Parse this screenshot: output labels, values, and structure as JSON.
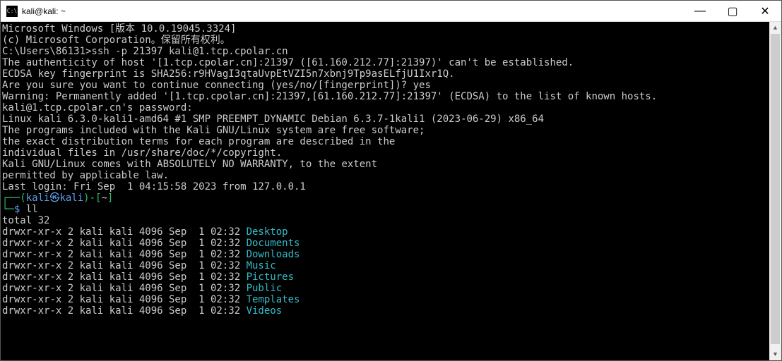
{
  "titlebar": {
    "icon_label": "C:\\",
    "title": "kali@kali: ~"
  },
  "window_controls": {
    "minimize": "—",
    "maximize": "▢",
    "close": "✕"
  },
  "scrollbar": {
    "up": "▲",
    "down": "▼"
  },
  "term": {
    "l1": "Microsoft Windows [版本 10.0.19045.3324]",
    "l2": "(c) Microsoft Corporation。保留所有权利。",
    "blank": "",
    "l3": "C:\\Users\\86131>ssh -p 21397 kali@1.tcp.cpolar.cn",
    "l4": "The authenticity of host '[1.tcp.cpolar.cn]:21397 ([61.160.212.77]:21397)' can't be established.",
    "l5": "ECDSA key fingerprint is SHA256:r9HVagI3qtaUvpEtVZI5n7xbnj9Tp9asELfjU1Ixr1Q.",
    "l6": "Are you sure you want to continue connecting (yes/no/[fingerprint])? yes",
    "l7": "Warning: Permanently added '[1.tcp.cpolar.cn]:21397,[61.160.212.77]:21397' (ECDSA) to the list of known hosts.",
    "l8": "kali@1.tcp.cpolar.cn's password:",
    "l9": "Linux kali 6.3.0-kali1-amd64 #1 SMP PREEMPT_DYNAMIC Debian 6.3.7-1kali1 (2023-06-29) x86_64",
    "l10": "The programs included with the Kali GNU/Linux system are free software;",
    "l11": "the exact distribution terms for each program are described in the",
    "l12": "individual files in /usr/share/doc/*/copyright.",
    "l13": "Kali GNU/Linux comes with ABSOLUTELY NO WARRANTY, to the extent",
    "l14": "permitted by applicable law.",
    "l15": "Last login: Fri Sep  1 04:15:58 2023 from 127.0.0.1",
    "prompt": {
      "corner_top": "┌──(",
      "user": "kali",
      "sep": "㉿",
      "host": "kali",
      "close_paren": ")-[",
      "cwd": "~",
      "end_bracket": "]",
      "corner_bot": "└─",
      "dollar": "$ ",
      "cmd": "ll"
    },
    "ls_total": "total 32",
    "ls_prefix": "drwxr-xr-x 2 kali kali 4096 Sep  1 02:32 ",
    "dirs": [
      "Desktop",
      "Documents",
      "Downloads",
      "Music",
      "Pictures",
      "Public",
      "Templates",
      "Videos"
    ]
  }
}
